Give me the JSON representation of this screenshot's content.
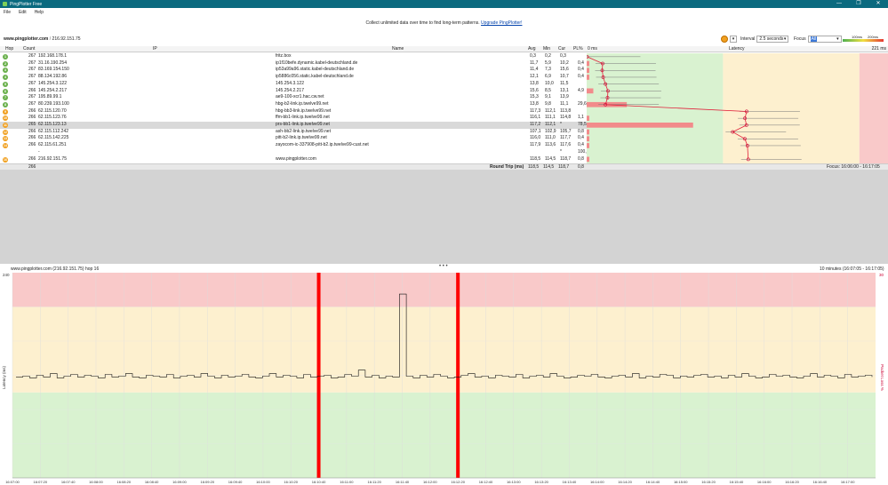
{
  "window": {
    "title": "PingPlotter Free",
    "minimize": "—",
    "maximize": "❐",
    "close": "✕"
  },
  "menu": [
    "File",
    "Edit",
    "Help"
  ],
  "promo": {
    "text": "Collect unlimited data over time to find long-term patterns.",
    "link": "Upgrade PingPlotter!"
  },
  "target": {
    "host": "www.pingplotter.com",
    "sep": "/",
    "ip": "216.92.151.75"
  },
  "controls": {
    "interval_label": "Interval",
    "interval_value": "2.5 seconds",
    "focus_label": "Focus",
    "focus_value": "All"
  },
  "legend": {
    "low": "100ms",
    "high": "200ms"
  },
  "columns": {
    "hop": "Hop",
    "count": "Count",
    "ip": "IP",
    "name": "Name",
    "avg": "Avg",
    "min": "Min",
    "cur": "Cur",
    "pl": "PL%",
    "latency_min": "0 ms",
    "latency": "Latency",
    "latency_max": "221 ms"
  },
  "colors": {
    "green": "#d9f2d0",
    "yellow": "#fdf0cf",
    "red": "#f9c9c9",
    "hop_green": "#6ab04c",
    "hop_orange": "#f0a020",
    "spike": "#ff0000"
  },
  "hops": [
    {
      "hop": "1",
      "count": "267",
      "ip": "192.168.178.1",
      "name": "fritz.box",
      "avg": "0,3",
      "min": "0,2",
      "cur": "0,3",
      "pl": "",
      "status": "green",
      "lat": 0.3,
      "pl_val": 0
    },
    {
      "hop": "2",
      "count": "267",
      "ip": "31.16.190.254",
      "name": "ip1f10befe.dynamic.kabel-deutschland.de",
      "avg": "11,7",
      "min": "5,9",
      "cur": "10,2",
      "pl": "0,4",
      "status": "green",
      "lat": 11.7,
      "pl_val": 0.4
    },
    {
      "hop": "3",
      "count": "267",
      "ip": "83.169.154.150",
      "name": "ip53a99a96.static.kabel-deutschland.de",
      "avg": "11,4",
      "min": "7,3",
      "cur": "15,6",
      "pl": "0,4",
      "status": "green",
      "lat": 11.4,
      "pl_val": 0.4
    },
    {
      "hop": "4",
      "count": "267",
      "ip": "88.134.192.86",
      "name": "ip5886c056.static.kabel-deutschland.de",
      "avg": "12,1",
      "min": "6,9",
      "cur": "10,7",
      "pl": "0,4",
      "status": "green",
      "lat": 12.1,
      "pl_val": 0.4
    },
    {
      "hop": "5",
      "count": "267",
      "ip": "145.254.3.122",
      "name": "145.254.3.122",
      "avg": "13,8",
      "min": "10,0",
      "cur": "11,5",
      "pl": "",
      "status": "green",
      "lat": 13.8,
      "pl_val": 0
    },
    {
      "hop": "6",
      "count": "266",
      "ip": "145.254.2.217",
      "name": "145.254.2.217",
      "avg": "15,6",
      "min": "8,5",
      "cur": "13,1",
      "pl": "4,9",
      "status": "green",
      "lat": 15.6,
      "pl_val": 4.9
    },
    {
      "hop": "7",
      "count": "267",
      "ip": "195.89.99.1",
      "name": "ae9-100-xcr1.hac.cw.net",
      "avg": "15,3",
      "min": "9,1",
      "cur": "13,9",
      "pl": "",
      "status": "green",
      "lat": 15.3,
      "pl_val": 0
    },
    {
      "hop": "8",
      "count": "267",
      "ip": "80.239.193.100",
      "name": "hbg-b2-link.ip.twelve99.net",
      "avg": "13,8",
      "min": "9,8",
      "cur": "11,1",
      "pl": "29,6",
      "status": "green",
      "lat": 13.8,
      "pl_val": 29.6
    },
    {
      "hop": "9",
      "count": "266",
      "ip": "62.115.120.70",
      "name": "hbg-bb3-link.ip.twelve99.net",
      "avg": "117,3",
      "min": "112,1",
      "cur": "113,8",
      "pl": "",
      "status": "orange",
      "lat": 117.3,
      "pl_val": 0
    },
    {
      "hop": "10",
      "count": "266",
      "ip": "62.115.123.76",
      "name": "ffm-bb1-link.ip.twelve99.net",
      "avg": "116,1",
      "min": "111,1",
      "cur": "114,8",
      "pl": "1,1",
      "status": "orange",
      "lat": 116.1,
      "pl_val": 1.1
    },
    {
      "hop": "11",
      "count": "265",
      "ip": "62.115.123.13",
      "name": "prs-bb1-link.ip.twelve99.net",
      "avg": "117,2",
      "min": "112,1",
      "cur": "*",
      "pl": "78,5",
      "status": "orange",
      "lat": 117.2,
      "pl_val": 78.5
    },
    {
      "hop": "12",
      "count": "266",
      "ip": "62.115.112.242",
      "name": "ash-bb2-link.ip.twelve99.net",
      "avg": "107,1",
      "min": "102,9",
      "cur": "105,7",
      "pl": "0,8",
      "status": "orange",
      "lat": 107.1,
      "pl_val": 0.8
    },
    {
      "hop": "13",
      "count": "266",
      "ip": "62.115.142.225",
      "name": "pitt-b2-link.ip.twelve99.net",
      "avg": "116,0",
      "min": "111,0",
      "cur": "117,7",
      "pl": "0,4",
      "status": "orange",
      "lat": 116.0,
      "pl_val": 0.4
    },
    {
      "hop": "14",
      "count": "266",
      "ip": "62.115.61.251",
      "name": "zayocom-ic-337908-pitt-b2.ip.twelve99-cust.net",
      "avg": "117,9",
      "min": "113,6",
      "cur": "117,6",
      "pl": "0,4",
      "status": "orange",
      "lat": 117.9,
      "pl_val": 0.4
    },
    {
      "hop": "",
      "count": "",
      "ip": "-",
      "name": "",
      "avg": "",
      "min": "",
      "cur": "*",
      "pl": "100,0",
      "status": "none",
      "lat": null,
      "pl_val": 0
    },
    {
      "hop": "16",
      "count": "266",
      "ip": "216.92.151.75",
      "name": "www.pingplotter.com",
      "avg": "118,5",
      "min": "114,5",
      "cur": "118,7",
      "pl": "0,8",
      "status": "orange",
      "lat": 118.5,
      "pl_val": 0.8
    }
  ],
  "roundtrip": {
    "count": "266",
    "label": "Round Trip (ms)",
    "avg": "118,5",
    "min": "114,5",
    "cur": "118,7",
    "pl": "0,8",
    "focus": "Focus: 16:06:00 - 16:17:05"
  },
  "lower": {
    "title": "www.pingplotter.com (216.92.151.75) hop 16",
    "range": "10 minutes (16:07:05 - 16:17:05)",
    "ymax": "240",
    "pl_max": "30",
    "ylabel": "Latency (ms)",
    "pl_label": "Packet Loss %",
    "dots": "• • •"
  },
  "chart_data": {
    "type": "line",
    "title": "",
    "xlabel": "",
    "ylabel": "Latency (ms)",
    "ylim": [
      0,
      240
    ],
    "x_ticks": [
      "16:07:00",
      "16:07:20",
      "16:07:40",
      "16:08:00",
      "16:08:20",
      "16:08:40",
      "16:09:00",
      "16:09:20",
      "16:09:40",
      "16:10:00",
      "16:10:20",
      "16:10:40",
      "16:11:00",
      "16:11:20",
      "16:11:40",
      "16:12:00",
      "16:12:20",
      "16:12:40",
      "16:13:00",
      "16:13:20",
      "16:13:40",
      "16:14:00",
      "16:14:20",
      "16:14:40",
      "16:15:00",
      "16:15:20",
      "16:15:40",
      "16:16:00",
      "16:16:20",
      "16:16:40",
      "16:17:00"
    ],
    "bands": [
      {
        "from": 0,
        "to": 100,
        "color": "#d9f2d0"
      },
      {
        "from": 100,
        "to": 200,
        "color": "#fdf0cf"
      },
      {
        "from": 200,
        "to": 240,
        "color": "#f9c9c9"
      }
    ],
    "loss_events_x": [
      "16:10:40",
      "16:12:20"
    ],
    "spike": {
      "x": "16:11:22",
      "value": 215
    },
    "series": [
      {
        "values": [
          118,
          119,
          117,
          120,
          118,
          122,
          117,
          119,
          121,
          118,
          120,
          119,
          117,
          121,
          118,
          119,
          122,
          118,
          117,
          120,
          119,
          118,
          121,
          117,
          119,
          120,
          118,
          122,
          119,
          117,
          120,
          118,
          119,
          121,
          118,
          117,
          119,
          122,
          118,
          120,
          119,
          117,
          121,
          118,
          119,
          120,
          117,
          118,
          121,
          119,
          126,
          118,
          120,
          117,
          119,
          118,
          215,
          119,
          117,
          120,
          118,
          121,
          119,
          117,
          118,
          120,
          122,
          118,
          119,
          117,
          120,
          119,
          118,
          121,
          117,
          119,
          120,
          118,
          122,
          119,
          117,
          118,
          120,
          119,
          121,
          118,
          117,
          119,
          120,
          118,
          122,
          117,
          119,
          118,
          121,
          120,
          117,
          119,
          118,
          120,
          121,
          118,
          119,
          117,
          120,
          118,
          122,
          119,
          117,
          118,
          121,
          119,
          120,
          118,
          117,
          119,
          122,
          118,
          120,
          119,
          117,
          121,
          118,
          119,
          120,
          118
        ]
      }
    ]
  }
}
